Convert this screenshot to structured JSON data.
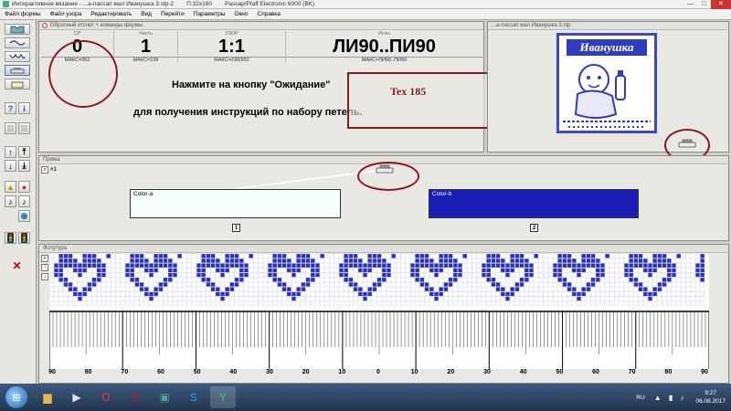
{
  "window": {
    "title_segments": [
      "Интерактивное вязание - ...а-пассап мал Иванушка 3.stp-2",
      "П:32x160",
      "Passap/Pfaff Electronic 6000 (BK)"
    ],
    "controls": {
      "minimize": "—",
      "maximize": "□",
      "close": "✕"
    }
  },
  "menu": [
    "Файл формы",
    "Файл узора",
    "Редактировать",
    "Вид",
    "Перейти",
    "Параметры",
    "Окно",
    "Справка"
  ],
  "counter_panel": {
    "title": "Обратный отсчет + команды формы",
    "cells": [
      {
        "label": "СР",
        "value": "0",
        "max": "МАКС=952"
      },
      {
        "label": "Часть",
        "value": "1",
        "max": "МАКС=238"
      },
      {
        "label": "УЗОР",
        "value": "1:1",
        "max": "МАКС=238/952"
      },
      {
        "label": "Иглы",
        "value": "ЛИ90..ПИ90",
        "max": "МАКС=ЛИ90..ПИ90"
      }
    ],
    "instruction_line1": "Нажмите на кнопку \"Ожидание\"",
    "instruction_line2": "для получения инструкций по набору петель.",
    "annotation": "Tex  185"
  },
  "preview_panel": {
    "title": "...а-пассап мал Иванушка 3.stp",
    "card_title": "Иванушка"
  },
  "yarn_panel": {
    "title": "Пряжа",
    "row_label": "#1",
    "yarns": [
      {
        "name": "Color-a",
        "number": "1",
        "color": "#f4fffe"
      },
      {
        "name": "Color-b",
        "number": "2",
        "color": "#1a1eb5"
      }
    ]
  },
  "pattern_panel": {
    "title": "Фотутура",
    "stitch_color": "#2b32b8",
    "ruler": [
      "90",
      "80",
      "70",
      "60",
      "50",
      "40",
      "30",
      "20",
      "10",
      "0",
      "10",
      "20",
      "30",
      "40",
      "50",
      "60",
      "70",
      "80",
      "90"
    ]
  },
  "toolbar": {
    "help_label": "?",
    "info_label": "i",
    "note_label": "♪"
  },
  "taskbar": {
    "start": "⊞",
    "apps": [
      {
        "name": "folder",
        "glyph": "▆",
        "color": "#e8b84a"
      },
      {
        "name": "media",
        "glyph": "▶",
        "color": "#e0e0e0"
      },
      {
        "name": "opera",
        "glyph": "O",
        "color": "#e33"
      },
      {
        "name": "opera-red",
        "glyph": "O",
        "color": "#c11"
      },
      {
        "name": "pictures",
        "glyph": "▣",
        "color": "#4a9"
      },
      {
        "name": "skype",
        "glyph": "S",
        "color": "#1aa3e8"
      },
      {
        "name": "knitting",
        "glyph": "Y",
        "color": "#4c4"
      }
    ],
    "lang": "RU",
    "sys_icons": "▲ ▮ ♪",
    "time": "9:27",
    "date": "06.08.2017"
  }
}
